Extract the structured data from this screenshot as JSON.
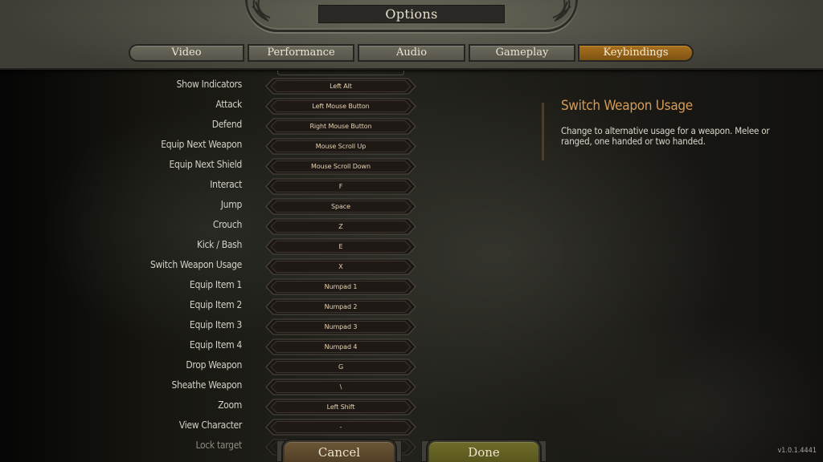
{
  "header": {
    "title": "Options",
    "tabs": [
      {
        "label": "Video",
        "active": false
      },
      {
        "label": "Performance",
        "active": false
      },
      {
        "label": "Audio",
        "active": false
      },
      {
        "label": "Gameplay",
        "active": false
      },
      {
        "label": "Keybindings",
        "active": true
      }
    ]
  },
  "keybindings": [
    {
      "action": "Show Indicators",
      "key": "Left Alt"
    },
    {
      "action": "Attack",
      "key": "Left Mouse Button"
    },
    {
      "action": "Defend",
      "key": "Right Mouse Button"
    },
    {
      "action": "Equip Next Weapon",
      "key": "Mouse Scroll Up"
    },
    {
      "action": "Equip Next Shield",
      "key": "Mouse Scroll Down"
    },
    {
      "action": "Interact",
      "key": "F"
    },
    {
      "action": "Jump",
      "key": "Space"
    },
    {
      "action": "Crouch",
      "key": "Z"
    },
    {
      "action": "Kick / Bash",
      "key": "E"
    },
    {
      "action": "Switch Weapon Usage",
      "key": "X"
    },
    {
      "action": "Equip Item 1",
      "key": "Numpad 1"
    },
    {
      "action": "Equip Item 2",
      "key": "Numpad 2"
    },
    {
      "action": "Equip Item 3",
      "key": "Numpad 3"
    },
    {
      "action": "Equip Item 4",
      "key": "Numpad 4"
    },
    {
      "action": "Drop Weapon",
      "key": "G"
    },
    {
      "action": "Sheathe Weapon",
      "key": "\\"
    },
    {
      "action": "Zoom",
      "key": "Left Shift"
    },
    {
      "action": "View Character",
      "key": "-"
    },
    {
      "action": "Lock target",
      "key": ""
    }
  ],
  "description": {
    "title": "Switch Weapon Usage",
    "text": "Change to alternative usage for a weapon. Melee or ranged, one handed or two handed."
  },
  "buttons": {
    "cancel": "Cancel",
    "done": "Done"
  },
  "version": "v1.0.1.4441",
  "colors": {
    "active_tab": "#a8701e",
    "description_title": "#d69b56",
    "key_text": "#e6d2b2",
    "cancel_button": "#6c5637",
    "done_button": "#6f6b2a"
  }
}
